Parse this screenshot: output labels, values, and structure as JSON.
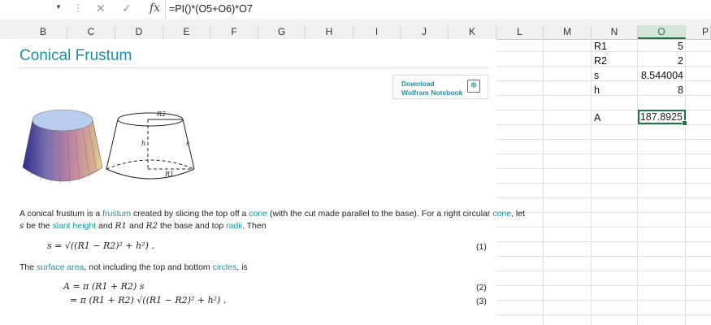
{
  "formula_bar": {
    "cancel_icon": "x-icon",
    "enter_icon": "check-icon",
    "fx_label": "fx",
    "formula": "=PI()*(O5+O6)*O7"
  },
  "columns": [
    "B",
    "C",
    "D",
    "E",
    "F",
    "G",
    "H",
    "I",
    "J",
    "K",
    "L",
    "M",
    "N",
    "O",
    "P"
  ],
  "selected_column": "O",
  "cells": {
    "N_r1": "R1",
    "O_r1": "5",
    "N_r2": "R2",
    "O_r2": "2",
    "N_r3": "s",
    "O_r3": "8.544004",
    "N_r4": "h",
    "O_r4": "8",
    "N_r6": "A",
    "O_r6": "187.8925"
  },
  "wolfram": {
    "title": "Conical Frustum",
    "download_line1": "Download",
    "download_line2": "Wolfram Notebook",
    "download_icon": "wolfram-notebook-icon",
    "diagram_labels": {
      "top_radius": "R2",
      "height": "h",
      "slant": "s",
      "bottom_radius": "R1"
    },
    "para1_a": "A conical frustum is a ",
    "para1_link1": "frustum",
    "para1_b": " created by slicing the top off a ",
    "para1_link2": "cone",
    "para1_c": " (with the cut made parallel to the base). For a right circular ",
    "para1_link3": "cone",
    "para1_d": ", let",
    "para2_s": "s",
    "para2_a": " be the ",
    "para2_link1": "slant height",
    "para2_b": " and ",
    "para2_r1": "R1",
    "para2_c": " and ",
    "para2_r2": "R2",
    "para2_d": " the base and top ",
    "para2_link2": "radii",
    "para2_e": ". Then",
    "eq1": "s = √((R1 − R2)² + h²) .",
    "eq1_no": "(1)",
    "para3_a": "The ",
    "para3_link1": "surface area",
    "para3_b": ", not including the top and bottom ",
    "para3_link2": "circles",
    "para3_c": ", is",
    "eq2": "A = π (R1 + R2) s",
    "eq2_no": "(2)",
    "eq3": "= π (R1 + R2) √((R1 − R2)² + h²) .",
    "eq3_no": "(3)"
  }
}
